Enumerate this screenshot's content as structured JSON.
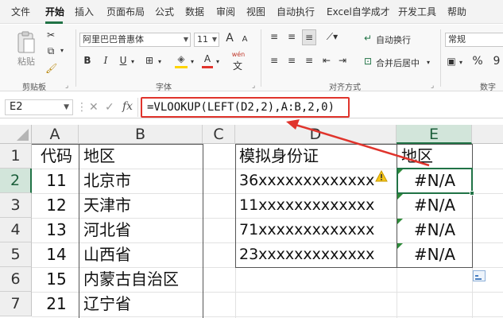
{
  "menu": {
    "tabs": [
      "文件",
      "开始",
      "插入",
      "页面布局",
      "公式",
      "数据",
      "审阅",
      "视图",
      "自动执行",
      "Excel自学成才",
      "开发工具",
      "帮助"
    ],
    "active_index": 1
  },
  "ribbon": {
    "clipboard": {
      "paste_label": "粘贴",
      "group_label": "剪贴板"
    },
    "font": {
      "font_name": "阿里巴巴普惠体",
      "font_size": "11",
      "bold": "B",
      "italic": "I",
      "underline": "U",
      "font_color_letter": "A",
      "wen_label": "wén",
      "group_label": "字体",
      "grow": "A",
      "shrink": "A"
    },
    "alignment": {
      "wrap_text": "自动换行",
      "merge_center": "合并后居中",
      "group_label": "对齐方式"
    },
    "number": {
      "format": "常规",
      "percent": "%",
      "comma": "9",
      "group_label": "数字"
    }
  },
  "formula_bar": {
    "name_box": "E2",
    "cancel": "✕",
    "confirm": "✓",
    "fx": "fx",
    "formula": "=VLOOKUP(LEFT(D2,2),A:B,2,0)"
  },
  "columns": [
    "A",
    "B",
    "C",
    "D",
    "E"
  ],
  "rows": [
    "1",
    "2",
    "3",
    "4",
    "5",
    "6",
    "7"
  ],
  "sheet": {
    "a": [
      "代码",
      "11",
      "12",
      "13",
      "14",
      "15",
      "21"
    ],
    "b": [
      "地区",
      "北京市",
      "天津市",
      "河北省",
      "山西省",
      "内蒙古自治区",
      "辽宁省"
    ],
    "d": [
      "模拟身份证",
      "36xxxxxxxxxxxxx",
      "11xxxxxxxxxxxxx",
      "71xxxxxxxxxxxxx",
      "23xxxxxxxxxxxxx"
    ],
    "e": [
      "地区",
      "#N/A",
      "#N/A",
      "#N/A",
      "#N/A"
    ]
  },
  "selection": {
    "cell": "E2",
    "column": "E",
    "row": "2"
  },
  "colors": {
    "accent": "#217346",
    "annotation": "#e0342c",
    "error_triangle": "#2e8b3a"
  }
}
